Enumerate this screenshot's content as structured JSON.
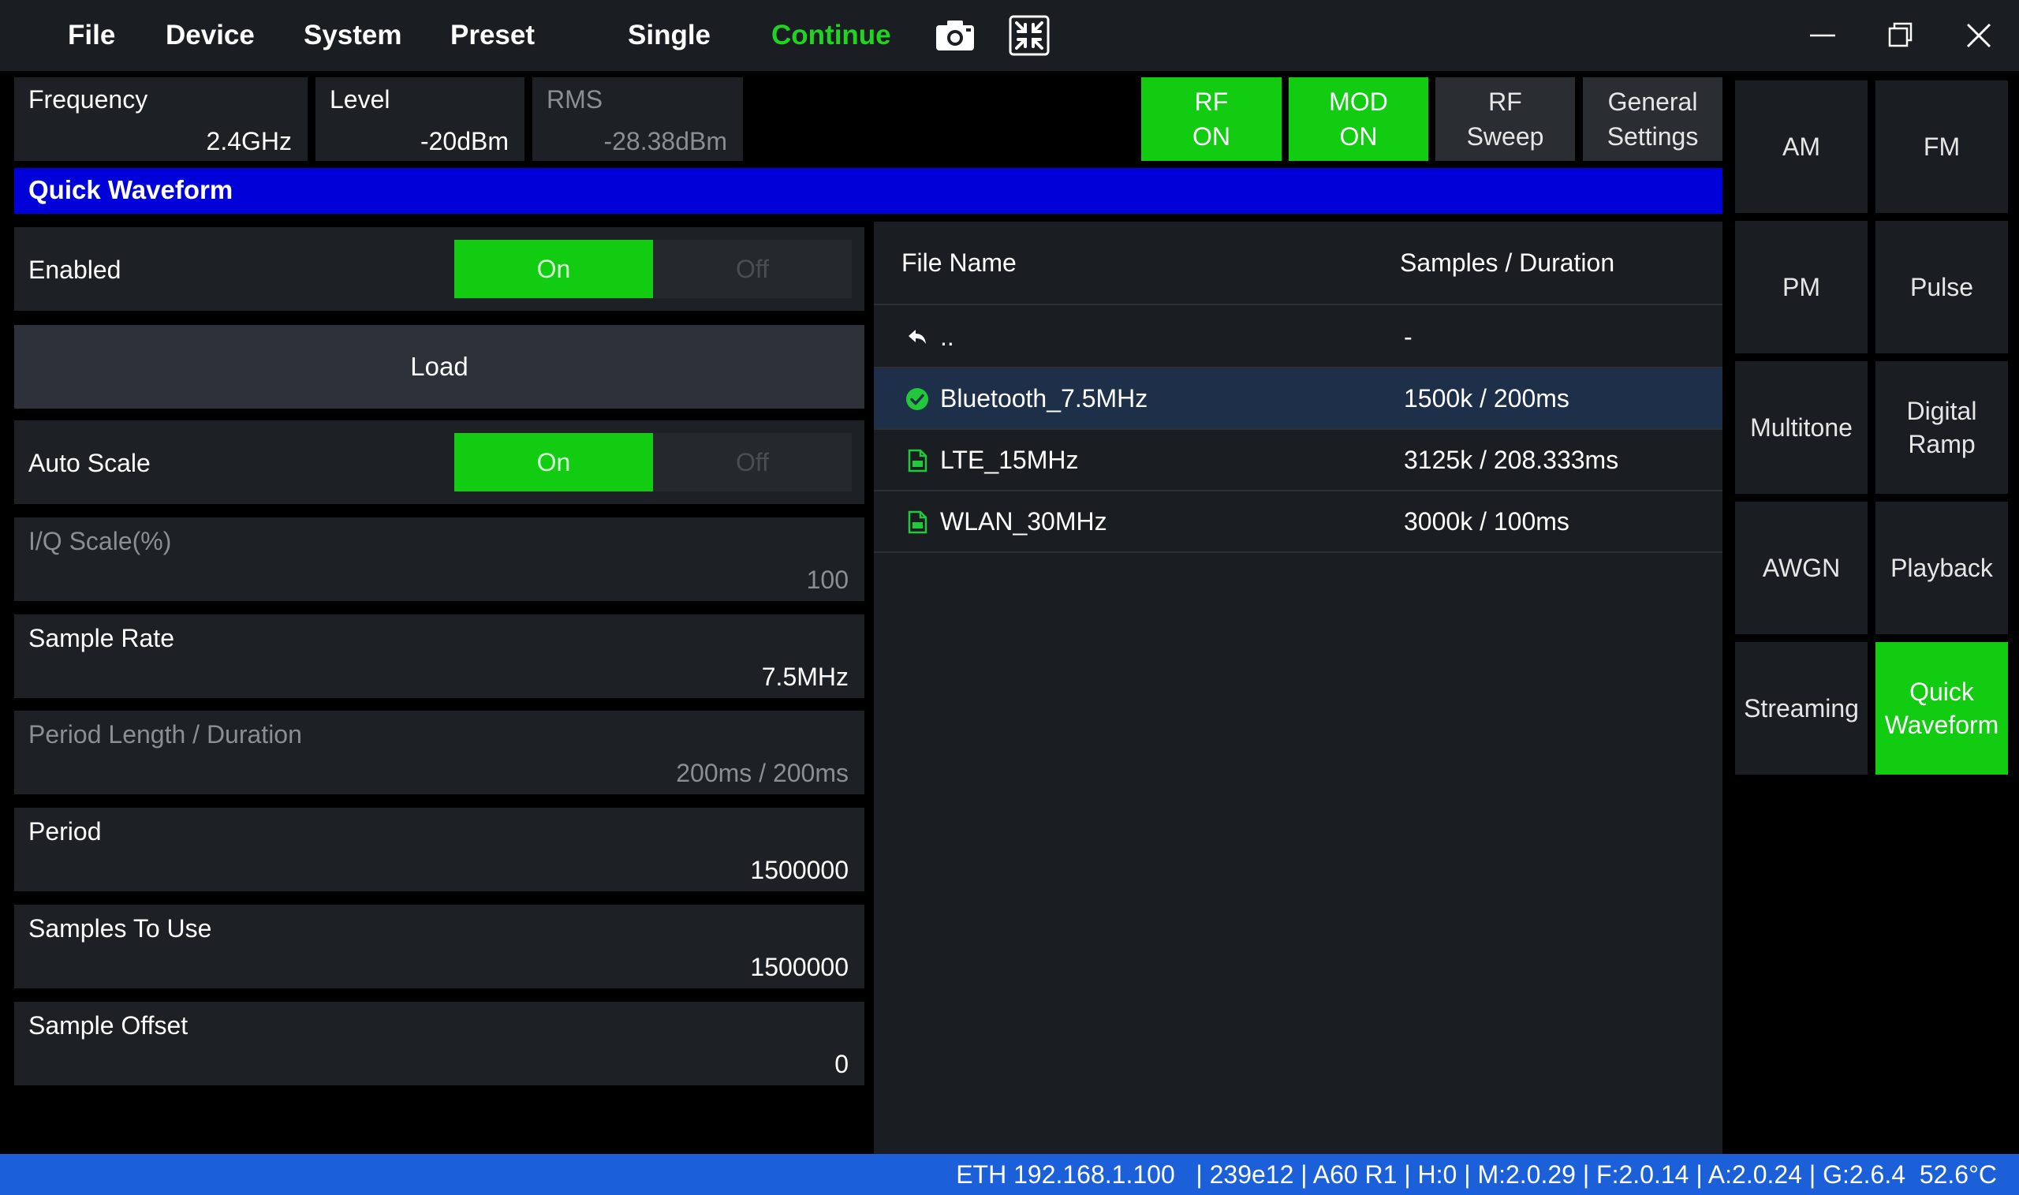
{
  "menu": {
    "file": "File",
    "device": "Device",
    "system": "System",
    "preset": "Preset",
    "single": "Single",
    "continue": "Continue"
  },
  "toolbar_icons": [
    "camera-icon",
    "fullscreen-exit-icon"
  ],
  "window_controls": [
    "minimize-icon",
    "restore-icon",
    "close-icon"
  ],
  "params": {
    "frequency": {
      "label": "Frequency",
      "value": "2.4GHz"
    },
    "level": {
      "label": "Level",
      "value": "-20dBm"
    },
    "rms": {
      "label": "RMS",
      "value": "-28.38dBm"
    }
  },
  "header_buttons": {
    "rf_on": {
      "line1": "RF",
      "line2": "ON"
    },
    "mod_on": {
      "line1": "MOD",
      "line2": "ON"
    },
    "rf_sweep": {
      "line1": "RF",
      "line2": "Sweep"
    },
    "general_settings": {
      "line1": "General",
      "line2": "Settings"
    }
  },
  "modes": {
    "am": "AM",
    "fm": "FM",
    "pm": "PM",
    "pulse": "Pulse",
    "multitone": "Multitone",
    "digital_ramp_1": "Digital",
    "digital_ramp_2": "Ramp",
    "awgn": "AWGN",
    "playback": "Playback",
    "streaming": "Streaming",
    "quick_waveform_1": "Quick",
    "quick_waveform_2": "Waveform",
    "active": "Quick Waveform"
  },
  "panel_title": "Quick Waveform",
  "settings": {
    "enabled": {
      "label": "Enabled",
      "on": "On",
      "off": "Off",
      "state": "On"
    },
    "load": "Load",
    "auto_scale": {
      "label": "Auto Scale",
      "on": "On",
      "off": "Off",
      "state": "On"
    },
    "iq_scale": {
      "label": "I/Q Scale(%)",
      "value": "100"
    },
    "sample_rate": {
      "label": "Sample Rate",
      "value": "7.5MHz"
    },
    "period_length": {
      "label": "Period Length / Duration",
      "value": "200ms / 200ms"
    },
    "period": {
      "label": "Period",
      "value": "1500000"
    },
    "samples_to_use": {
      "label": "Samples To Use",
      "value": "1500000"
    },
    "sample_offset": {
      "label": "Sample Offset",
      "value": "0"
    }
  },
  "file_table": {
    "headers": {
      "name": "File Name",
      "duration": "Samples / Duration"
    },
    "rows": [
      {
        "name": "..",
        "duration": "-",
        "icon": "back-arrow-icon"
      },
      {
        "name": "Bluetooth_7.5MHz",
        "duration": "1500k / 200ms",
        "icon": "check-circle-icon",
        "selected": true
      },
      {
        "name": "LTE_15MHz",
        "duration": "3125k / 208.333ms",
        "icon": "file-icon"
      },
      {
        "name": "WLAN_30MHz",
        "duration": "3000k / 100ms",
        "icon": "file-icon"
      }
    ]
  },
  "status": "ETH 192.168.1.100   | 239e12 | A60 R1 | H:0 | M:2.0.29 | F:2.0.14 | A:2.0.24 | G:2.6.4  52.6°C",
  "colors": {
    "active_green": "#11cc11",
    "title_blue": "#0000d8",
    "status_blue": "#1b5fd9",
    "continue_green": "#22d422",
    "selected_row": "#1e2f4a"
  }
}
